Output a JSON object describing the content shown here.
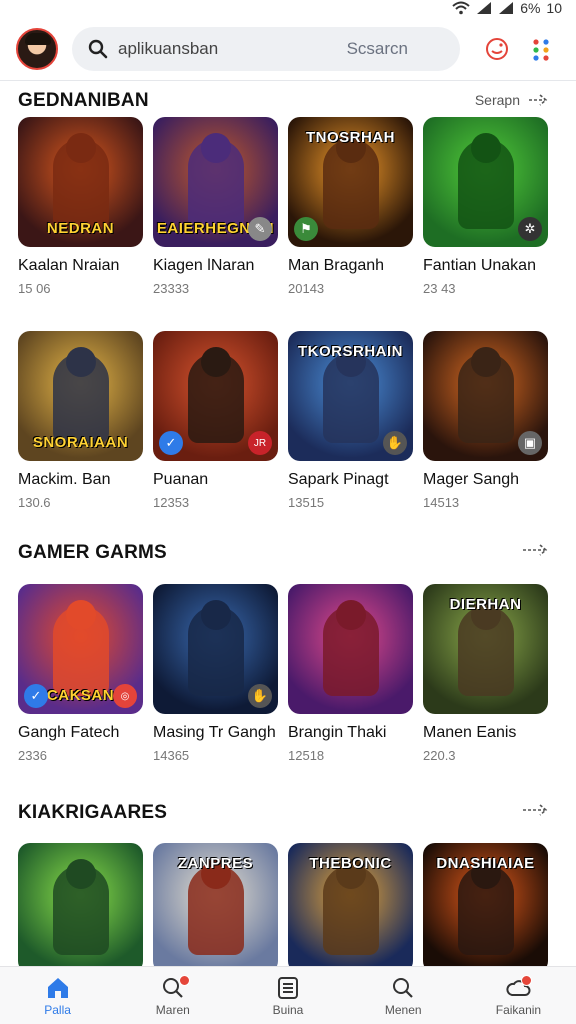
{
  "status": {
    "battery": "6%",
    "time": "10"
  },
  "header": {
    "search_value": "aplikuansban",
    "search_button": "Scsarcn"
  },
  "sections": [
    {
      "title": "GEDNANIBAN",
      "more": "Serapn",
      "games": [
        {
          "name": "Kaalan Nraian",
          "count": "15 06",
          "banner": "NEDRAN",
          "subbanner": "",
          "colors": [
            "#3b1616",
            "#d9581e"
          ],
          "fig": "#7a2a12",
          "badge": ""
        },
        {
          "name": "Kiagen lNaran",
          "count": "23333",
          "banner": "EAIERHEGNON",
          "colors": [
            "#3a1e5e",
            "#c25a2a"
          ],
          "fig": "#4b2c7a",
          "badge": "wrench"
        },
        {
          "name": "Man Braganh",
          "count": "20143",
          "banner": "TNOSRHAH",
          "colors": [
            "#2b1608",
            "#f29a2a"
          ],
          "fig": "#5a2c10",
          "badge": "flag"
        },
        {
          "name": "Fantian Unakan",
          "count": "23 43",
          "banner": "",
          "colors": [
            "#1e6e24",
            "#52cc3a"
          ],
          "fig": "#135314",
          "badge": "gear"
        }
      ]
    },
    {
      "title": "",
      "more": "",
      "games": [
        {
          "name": "Mackim. Ban",
          "count": "130.6",
          "banner": "SNORAIAAN",
          "colors": [
            "#5e4520",
            "#e6b648"
          ],
          "fig": "#2d3348",
          "badge": ""
        },
        {
          "name": "Puanan",
          "count": "12353",
          "banner": "",
          "colors": [
            "#6a1e10",
            "#d8542e"
          ],
          "fig": "#2a1a12",
          "badge": "check",
          "badge2": "JR"
        },
        {
          "name": "Sapark Pinagt",
          "count": "13515",
          "banner": "TKORSRHAIN",
          "colors": [
            "#1c2c5a",
            "#4b8ed8"
          ],
          "fig": "#26345c",
          "badge": "hand"
        },
        {
          "name": "Mager Sangh",
          "count": "14513",
          "banner": "",
          "colors": [
            "#2a140c",
            "#d86a22"
          ],
          "fig": "#3a2416",
          "badge": "box"
        }
      ]
    },
    {
      "title": "GAMER GARMS",
      "more": "",
      "games": [
        {
          "name": "Gangh Fatech",
          "count": "2336",
          "banner": "CAKSAN",
          "colors": [
            "#5a2c8a",
            "#e64b2a"
          ],
          "fig": "#e24a2a",
          "badge": "check",
          "badge2": "ring"
        },
        {
          "name": "Masing Tr Gangh",
          "count": "14365",
          "banner": "",
          "colors": [
            "#0e1a36",
            "#3a6ab0"
          ],
          "fig": "#182848",
          "badge": "hand"
        },
        {
          "name": "Brangin Thaki",
          "count": "12518",
          "banner": "",
          "colors": [
            "#4a1a6a",
            "#e24a8a"
          ],
          "fig": "#7a1a2a",
          "badge": ""
        },
        {
          "name": "Manen Eanis",
          "count": "220.3",
          "banner": "DIERHAN",
          "colors": [
            "#2c3a1a",
            "#8aa84a"
          ],
          "fig": "#4a3a22",
          "badge": ""
        }
      ]
    },
    {
      "title": "KIAKRIGAARES",
      "more": "",
      "games": [
        {
          "name": "",
          "count": "",
          "banner": "",
          "colors": [
            "#1e5a2a",
            "#8ae04a"
          ],
          "fig": "#1f4a22",
          "badge": ""
        },
        {
          "name": "",
          "count": "",
          "banner": "ZANPRES",
          "colors": [
            "#6a7aa0",
            "#e6e0d0"
          ],
          "fig": "#8a2a1a",
          "badge": ""
        },
        {
          "name": "",
          "count": "",
          "banner": "THEBONIC",
          "colors": [
            "#1a2a5a",
            "#e6a63a"
          ],
          "fig": "#5a3a1a",
          "badge": ""
        },
        {
          "name": "",
          "count": "",
          "banner": "DNASHIAIAE",
          "colors": [
            "#1a0c06",
            "#e25a1a"
          ],
          "fig": "#2a1810",
          "badge": ""
        }
      ]
    }
  ],
  "tabs": [
    {
      "label": "Palla",
      "icon": "home-icon",
      "active": true
    },
    {
      "label": "Maren",
      "icon": "search-badge-icon",
      "active": false
    },
    {
      "label": "Buina",
      "icon": "list-icon",
      "active": false
    },
    {
      "label": "Menen",
      "icon": "search-icon",
      "active": false
    },
    {
      "label": "Faikanin",
      "icon": "cloud-icon",
      "active": false
    }
  ],
  "accent": "#2f7be8"
}
